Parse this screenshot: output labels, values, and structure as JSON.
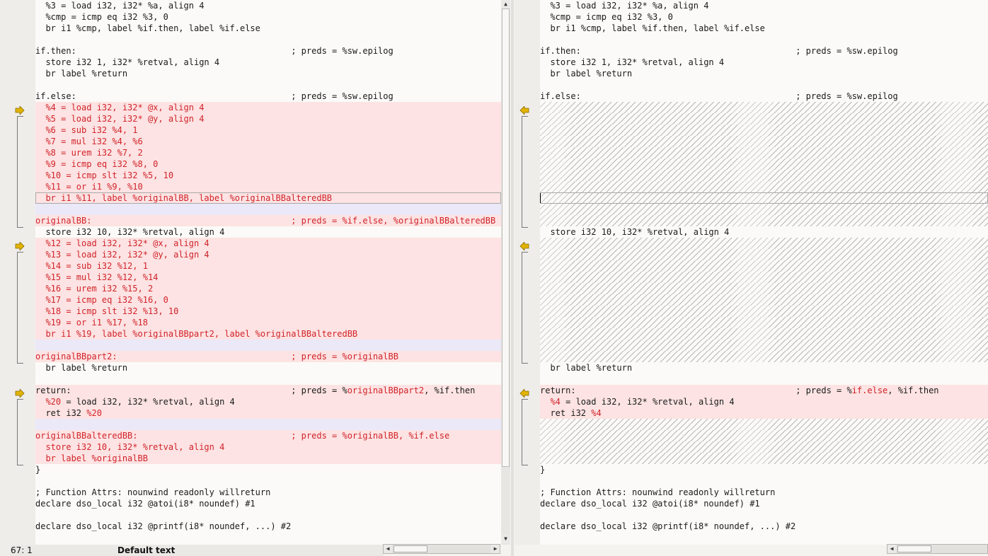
{
  "left": {
    "lines": [
      {
        "text": "  %3 = load i32, i32* %a, align 4",
        "type": "normal"
      },
      {
        "text": "  %cmp = icmp eq i32 %3, 0",
        "type": "normal"
      },
      {
        "text": "  br i1 %cmp, label %if.then, label %if.else",
        "type": "normal"
      },
      {
        "text": "",
        "type": "normal"
      },
      {
        "text": "if.then:                                          ; preds = %sw.epilog",
        "type": "normal"
      },
      {
        "text": "  store i32 1, i32* %retval, align 4",
        "type": "normal"
      },
      {
        "text": "  br label %return",
        "type": "normal"
      },
      {
        "text": "",
        "type": "normal"
      },
      {
        "text": "if.else:                                          ; preds = %sw.epilog",
        "type": "normal"
      },
      {
        "text": "  %4 = load i32, i32* @x, align 4",
        "type": "changed"
      },
      {
        "text": "  %5 = load i32, i32* @y, align 4",
        "type": "changed"
      },
      {
        "text": "  %6 = sub i32 %4, 1",
        "type": "changed"
      },
      {
        "text": "  %7 = mul i32 %4, %6",
        "type": "changed"
      },
      {
        "text": "  %8 = urem i32 %7, 2",
        "type": "changed"
      },
      {
        "text": "  %9 = icmp eq i32 %8, 0",
        "type": "changed"
      },
      {
        "text": "  %10 = icmp slt i32 %5, 10",
        "type": "changed"
      },
      {
        "text": "  %11 = or i1 %9, %10",
        "type": "changed"
      },
      {
        "text": "  br i1 %11, label %originalBB, label %originalBBalteredBB",
        "type": "changed",
        "boxed": true
      },
      {
        "text": "",
        "type": "moved"
      },
      {
        "text": "originalBB:                                       ; preds = %if.else, %originalBBalteredBB",
        "type": "changed"
      },
      {
        "text": "  store i32 10, i32* %retval, align 4",
        "type": "normal"
      },
      {
        "text": "  %12 = load i32, i32* @x, align 4",
        "type": "changed"
      },
      {
        "text": "  %13 = load i32, i32* @y, align 4",
        "type": "changed"
      },
      {
        "text": "  %14 = sub i32 %12, 1",
        "type": "changed"
      },
      {
        "text": "  %15 = mul i32 %12, %14",
        "type": "changed"
      },
      {
        "text": "  %16 = urem i32 %15, 2",
        "type": "changed"
      },
      {
        "text": "  %17 = icmp eq i32 %16, 0",
        "type": "changed"
      },
      {
        "text": "  %18 = icmp slt i32 %13, 10",
        "type": "changed"
      },
      {
        "text": "  %19 = or i1 %17, %18",
        "type": "changed"
      },
      {
        "text": "  br i1 %19, label %originalBBpart2, label %originalBBalteredBB",
        "type": "changed"
      },
      {
        "text": "",
        "type": "moved"
      },
      {
        "text": "originalBBpart2:                                  ; preds = %originalBB",
        "type": "changed"
      },
      {
        "text": "  br label %return",
        "type": "normal"
      },
      {
        "text": "",
        "type": "normal"
      },
      {
        "text": "return:                                           ; preds = %originalBBpart2, %if.then",
        "type": "changed",
        "hl_text": "return:                                           ; preds = %[originalBBpart2], %if.then"
      },
      {
        "text": "  %20 = load i32, i32* %retval, align 4",
        "type": "changed",
        "hl_text": "  [%20] = load i32, i32* %retval, align 4"
      },
      {
        "text": "  ret i32 %20",
        "type": "changed",
        "hl_text": "  ret i32 [%20]"
      },
      {
        "text": "",
        "type": "moved"
      },
      {
        "text": "originalBBalteredBB:                              ; preds = %originalBB, %if.else",
        "type": "changed"
      },
      {
        "text": "  store i32 10, i32* %retval, align 4",
        "type": "changed"
      },
      {
        "text": "  br label %originalBB",
        "type": "changed"
      },
      {
        "text": "}",
        "type": "normal"
      },
      {
        "text": "",
        "type": "normal"
      },
      {
        "text": "; Function Attrs: nounwind readonly willreturn",
        "type": "normal"
      },
      {
        "text": "declare dso_local i32 @atoi(i8* noundef) #1",
        "type": "normal"
      },
      {
        "text": "",
        "type": "normal"
      },
      {
        "text": "declare dso_local i32 @printf(i8* noundef, ...) #2",
        "type": "normal"
      },
      {
        "text": "",
        "type": "normal"
      }
    ]
  },
  "right": {
    "lines": [
      {
        "text": "  %3 = load i32, i32* %a, align 4",
        "type": "normal"
      },
      {
        "text": "  %cmp = icmp eq i32 %3, 0",
        "type": "normal"
      },
      {
        "text": "  br i1 %cmp, label %if.then, label %if.else",
        "type": "normal"
      },
      {
        "text": "",
        "type": "normal"
      },
      {
        "text": "if.then:                                          ; preds = %sw.epilog",
        "type": "normal"
      },
      {
        "text": "  store i32 1, i32* %retval, align 4",
        "type": "normal"
      },
      {
        "text": "  br label %return",
        "type": "normal"
      },
      {
        "text": "",
        "type": "normal"
      },
      {
        "text": "if.else:                                          ; preds = %sw.epilog",
        "type": "normal"
      },
      {
        "text": "",
        "type": "gap"
      },
      {
        "text": "",
        "type": "gap"
      },
      {
        "text": "",
        "type": "gap"
      },
      {
        "text": "",
        "type": "gap"
      },
      {
        "text": "",
        "type": "gap"
      },
      {
        "text": "",
        "type": "gap"
      },
      {
        "text": "",
        "type": "gap"
      },
      {
        "text": "",
        "type": "gap"
      },
      {
        "text": "",
        "type": "gap",
        "caret": true,
        "boxed": true
      },
      {
        "text": "",
        "type": "gap"
      },
      {
        "text": "",
        "type": "gap"
      },
      {
        "text": "  store i32 10, i32* %retval, align 4",
        "type": "normal"
      },
      {
        "text": "",
        "type": "gap"
      },
      {
        "text": "",
        "type": "gap"
      },
      {
        "text": "",
        "type": "gap"
      },
      {
        "text": "",
        "type": "gap"
      },
      {
        "text": "",
        "type": "gap"
      },
      {
        "text": "",
        "type": "gap"
      },
      {
        "text": "",
        "type": "gap"
      },
      {
        "text": "",
        "type": "gap"
      },
      {
        "text": "",
        "type": "gap"
      },
      {
        "text": "",
        "type": "gap"
      },
      {
        "text": "",
        "type": "gap"
      },
      {
        "text": "  br label %return",
        "type": "normal"
      },
      {
        "text": "",
        "type": "normal"
      },
      {
        "text": "return:                                           ; preds = %if.else, %if.then",
        "type": "changed",
        "hl_text": "return:                                           ; preds = %[if.else], %if.then",
        "plain": true
      },
      {
        "text": "  %4 = load i32, i32* %retval, align 4",
        "type": "changed",
        "hl_text": "  [%4] = load i32, i32* %retval, align 4",
        "plain": true
      },
      {
        "text": "  ret i32 %4",
        "type": "changed",
        "hl_text": "  ret i32 [%4]",
        "plain": true
      },
      {
        "text": "",
        "type": "gap"
      },
      {
        "text": "",
        "type": "gap"
      },
      {
        "text": "",
        "type": "gap"
      },
      {
        "text": "",
        "type": "gap"
      },
      {
        "text": "}",
        "type": "normal"
      },
      {
        "text": "",
        "type": "normal"
      },
      {
        "text": "; Function Attrs: nounwind readonly willreturn",
        "type": "normal"
      },
      {
        "text": "declare dso_local i32 @atoi(i8* noundef) #1",
        "type": "normal"
      },
      {
        "text": "",
        "type": "normal"
      },
      {
        "text": "declare dso_local i32 @printf(i8* noundef, ...) #2",
        "type": "normal"
      },
      {
        "text": "",
        "type": "normal"
      }
    ]
  },
  "status": {
    "cursor_position": "67: 1",
    "text_style": "Default text"
  },
  "colors": {
    "changed_bg": "#fde3e3",
    "changed_text": "#d0232a",
    "moved_bg": "#ebe9f8",
    "arrow": "#e2b300"
  },
  "icons": [
    "diff-arrow-right-icon",
    "diff-arrow-left-icon",
    "scroll-up-icon",
    "scroll-down-icon",
    "scroll-left-icon",
    "scroll-right-icon"
  ]
}
